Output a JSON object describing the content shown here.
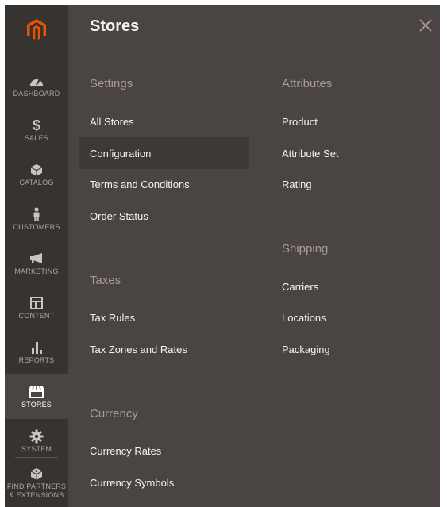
{
  "sidebar": {
    "logo_icon": "magento-logo-icon",
    "accent_color": "#eb5202",
    "items": [
      {
        "label": "DASHBOARD",
        "icon": "speedometer-icon"
      },
      {
        "label": "SALES",
        "icon": "dollar-icon"
      },
      {
        "label": "CATALOG",
        "icon": "box-icon"
      },
      {
        "label": "CUSTOMERS",
        "icon": "person-icon"
      },
      {
        "label": "MARKETING",
        "icon": "megaphone-icon"
      },
      {
        "label": "CONTENT",
        "icon": "layout-icon"
      },
      {
        "label": "REPORTS",
        "icon": "bar-chart-icon"
      },
      {
        "label": "STORES",
        "icon": "storefront-icon"
      },
      {
        "label": "SYSTEM",
        "icon": "gear-icon"
      },
      {
        "label_line1": "FIND PARTNERS",
        "label_line2": "& EXTENSIONS",
        "icon": "puzzle-cube-icon"
      }
    ],
    "active": "STORES"
  },
  "panel": {
    "title": "Stores",
    "close_icon": "close-icon",
    "settings": {
      "title": "Settings",
      "links": [
        "All Stores",
        "Configuration",
        "Terms and Conditions",
        "Order Status"
      ]
    },
    "taxes": {
      "title": "Taxes",
      "links": [
        "Tax Rules",
        "Tax Zones and Rates"
      ]
    },
    "currency": {
      "title": "Currency",
      "links": [
        "Currency Rates",
        "Currency Symbols"
      ]
    },
    "attributes": {
      "title": "Attributes",
      "links": [
        "Product",
        "Attribute Set",
        "Rating"
      ]
    },
    "shipping": {
      "title": "Shipping",
      "links": [
        "Carriers",
        "Locations",
        "Packaging"
      ]
    },
    "highlighted": "Configuration"
  }
}
